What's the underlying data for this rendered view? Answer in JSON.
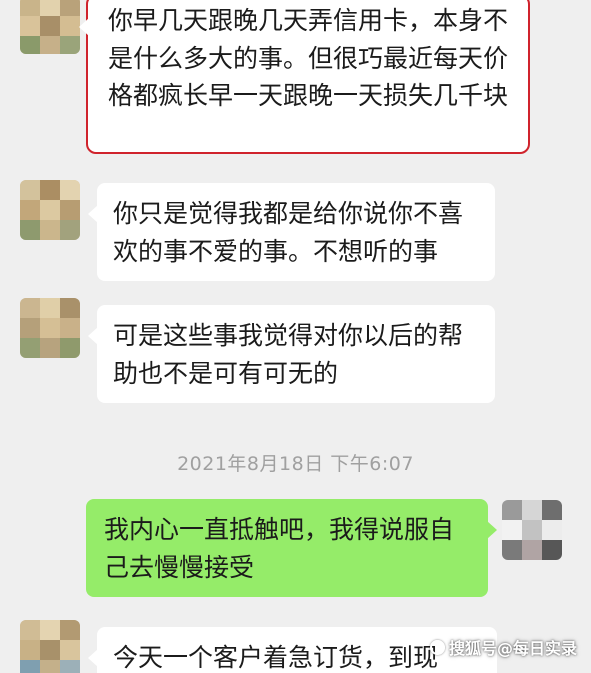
{
  "chat": {
    "messages": [
      {
        "side": "left",
        "text": "你早几天跟晚几天弄信用卡，本身不是什么多大的事。但很巧最近每天价格都疯长早一天跟晚一天损失几千块",
        "highlighted": true
      },
      {
        "side": "left",
        "text": "你只是觉得我都是给你说你不喜欢的事不爱的事。不想听的事"
      },
      {
        "side": "left",
        "text": "可是这些事我觉得对你以后的帮助也不是可有可无的"
      },
      {
        "side": "right",
        "text": "我内心一直抵触吧，我得说服自己去慢慢接受"
      },
      {
        "side": "left",
        "text": "今天一个客户着急订货，到现"
      }
    ],
    "timestamp": "2021年8月18日 下午6:07"
  },
  "watermark": {
    "text": "搜狐号@每日实录"
  },
  "colors": {
    "background": "#efefef",
    "incoming_bubble": "#ffffff",
    "outgoing_bubble": "#95ec69",
    "highlight_border": "#d0232c",
    "timestamp_text": "#a0a0a0"
  }
}
